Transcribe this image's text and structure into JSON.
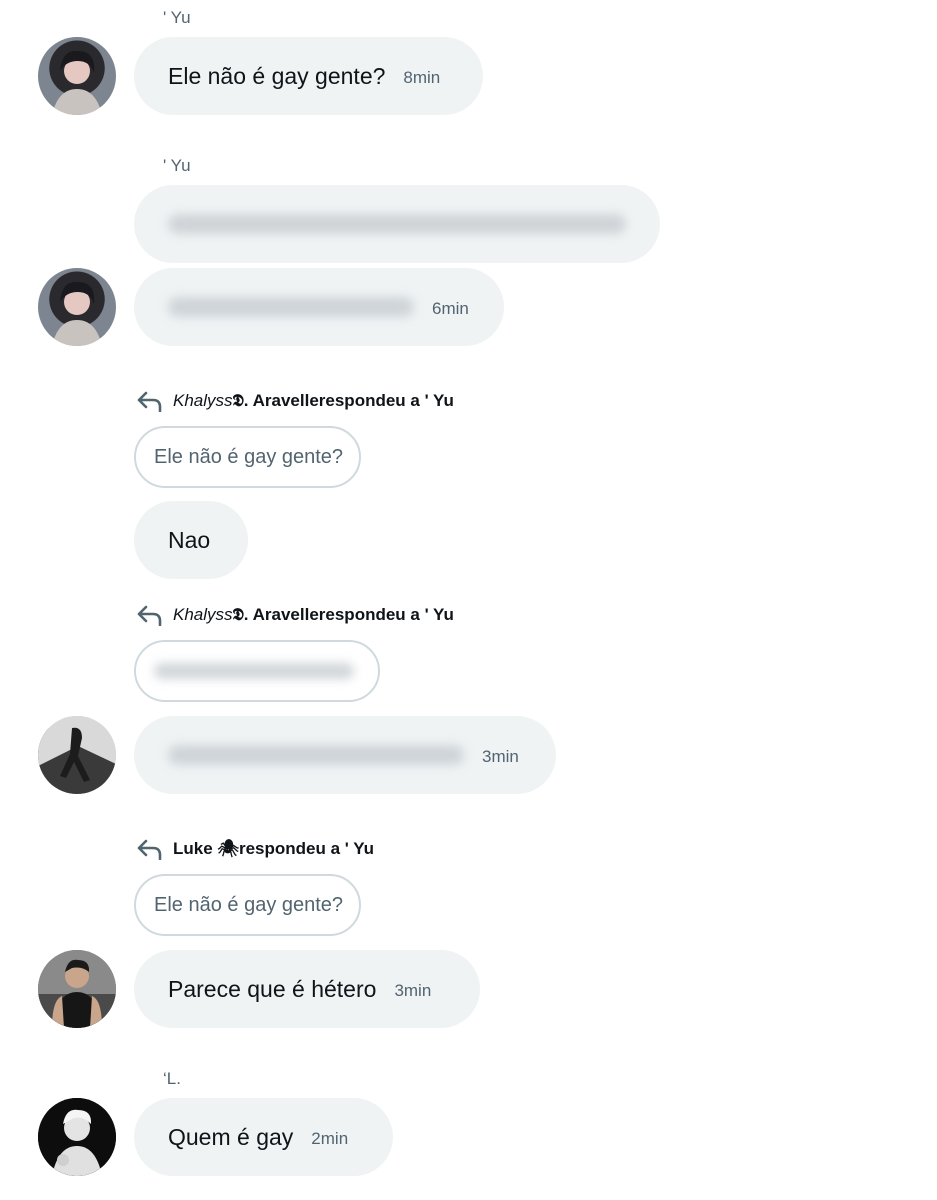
{
  "messages": [
    {
      "sender": "' Yu",
      "text": "Ele não é gay gente?",
      "time": "8min"
    },
    {
      "sender": "' Yu",
      "time": "6min"
    },
    {
      "reply": {
        "from_italic": "Khalyss",
        "from_rest": " 𝕯. Aravelle",
        "label": " respondeu a ' Yu",
        "quote": "Ele não é gay gente?"
      },
      "text": "Nao"
    },
    {
      "reply": {
        "from_italic": "Khalyss",
        "from_rest": " 𝕯. Aravelle",
        "label": " respondeu a ' Yu"
      },
      "time": "3min"
    },
    {
      "reply": {
        "from_italic": "",
        "from_rest": "Luke 🕷",
        "label": " respondeu a ' Yu",
        "quote": "Ele não é gay gente?"
      },
      "text": "Parece que é hétero",
      "time": "3min"
    },
    {
      "sender": "‘L.",
      "text": "Quem é gay",
      "time": "2min"
    }
  ],
  "colors": {
    "bubble": "#eff3f4",
    "secondary_text": "#536471",
    "quote_border": "#cfd9de"
  },
  "icons": {
    "reply": "reply-arrow-icon"
  }
}
